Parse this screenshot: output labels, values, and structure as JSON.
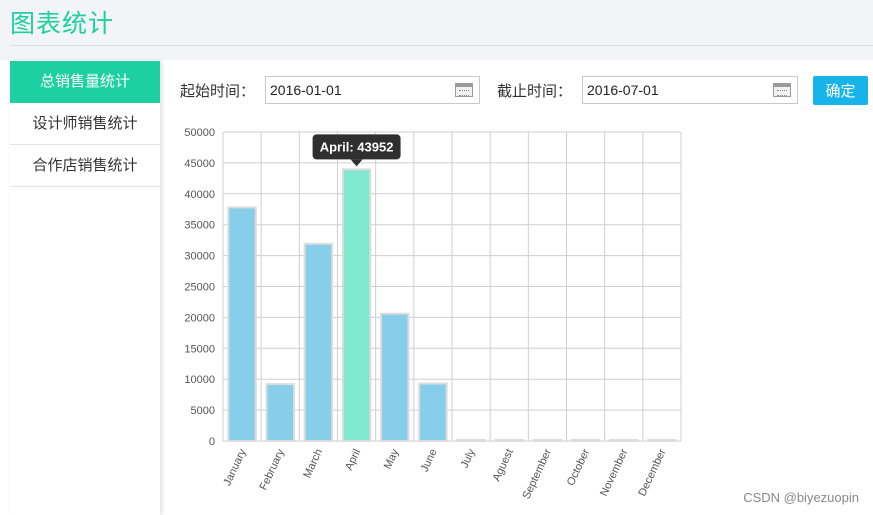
{
  "header": {
    "title": "图表统计"
  },
  "sidebar": {
    "items": [
      {
        "label": "总销售量统计",
        "active": true
      },
      {
        "label": "设计师销售统计",
        "active": false
      },
      {
        "label": "合作店销售统计",
        "active": false
      }
    ]
  },
  "filters": {
    "start_label": "起始时间：",
    "start_value": "2016-01-01",
    "end_label": "截止时间：",
    "end_value": "2016-07-01",
    "confirm_label": "确定"
  },
  "colors": {
    "accent": "#1dd0a1",
    "button": "#16b4ea",
    "bar": "#87ceeb",
    "bar_highlight": "#7fe8cf"
  },
  "chart_data": {
    "type": "bar",
    "categories": [
      "January",
      "February",
      "March",
      "April",
      "May",
      "June",
      "July",
      "Aguest",
      "September",
      "October",
      "November",
      "December"
    ],
    "values": [
      37800,
      9200,
      31900,
      43952,
      20600,
      9300,
      0,
      0,
      0,
      0,
      0,
      0
    ],
    "ylim": [
      0,
      50000
    ],
    "yticks": [
      0,
      5000,
      10000,
      15000,
      20000,
      25000,
      30000,
      35000,
      40000,
      45000,
      50000
    ],
    "grid": true,
    "highlight_index": 3,
    "tooltip": "April: 43952"
  },
  "watermark": "CSDN @biyezuopin"
}
